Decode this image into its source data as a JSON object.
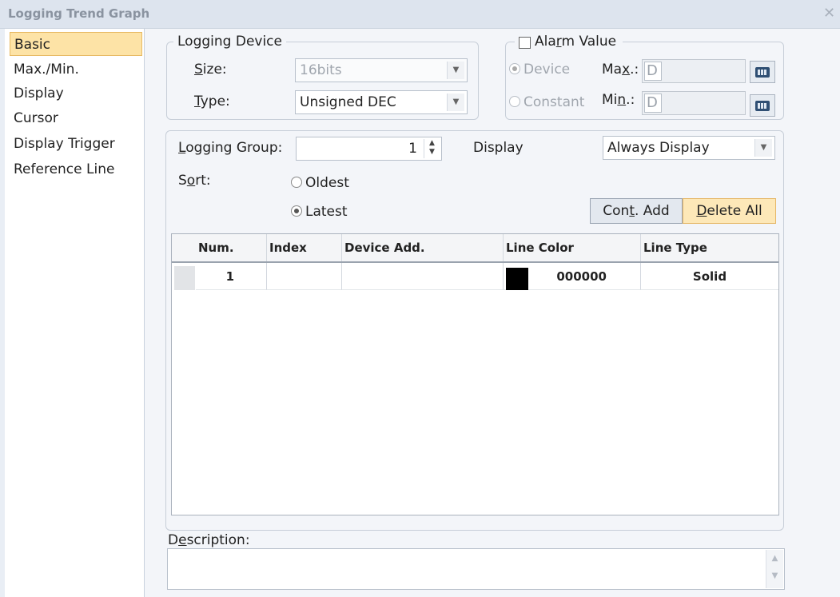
{
  "window": {
    "title": "Logging Trend Graph",
    "close_glyph": "✕"
  },
  "sidebar": {
    "items": [
      {
        "label": "Basic",
        "selected": true
      },
      {
        "label": "Max./Min.",
        "selected": false
      },
      {
        "label": "Display",
        "selected": false
      },
      {
        "label": "Cursor",
        "selected": false
      },
      {
        "label": "Display Trigger",
        "selected": false
      },
      {
        "label": "Reference Line",
        "selected": false
      }
    ]
  },
  "logging_device": {
    "legend": "Logging Device",
    "size_label_pre": "",
    "size_label_key": "S",
    "size_label_post": "ize:",
    "size_value": "16bits",
    "type_label_key": "T",
    "type_label_post": "ype:",
    "type_value": "Unsigned DEC"
  },
  "alarm": {
    "legend_pre": "Ala",
    "legend_key": "r",
    "legend_post": "m Value",
    "checked": false,
    "device_label": "Device",
    "constant_label": "Constant",
    "max_label_pre": "Ma",
    "max_label_key": "x",
    "max_label_post": ".:",
    "min_label_pre": "Mi",
    "min_label_key": "n",
    "min_label_post": ".:",
    "max_value": "D",
    "min_value": "D"
  },
  "group": {
    "logging_group_key": "L",
    "logging_group_post": "ogging Group:",
    "logging_group_value": "1",
    "display_label": "Display",
    "display_value": "Always Display",
    "sort_label_pre": "S",
    "sort_label_key": "o",
    "sort_label_post": "rt:",
    "sort_oldest": "Oldest",
    "sort_latest": "Latest",
    "sort_selected": "Latest",
    "cont_add_pre": "Con",
    "cont_add_key": "t",
    "cont_add_post": ". Add",
    "delete_all_key": "D",
    "delete_all_post": "elete All"
  },
  "table": {
    "columns": [
      "Num.",
      "Index",
      "Device Add.",
      "Line Color",
      "Line Type"
    ],
    "rows": [
      {
        "num": "1",
        "index": "",
        "device_add": "",
        "line_color": "000000",
        "line_type": "Solid"
      }
    ]
  },
  "description": {
    "label_pre": "D",
    "label_key": "e",
    "label_post": "scription:",
    "value": ""
  },
  "colors": {
    "selected_bg": "#fde3a6",
    "accent_btn": "#fde8b8",
    "swatch": "#000000"
  }
}
